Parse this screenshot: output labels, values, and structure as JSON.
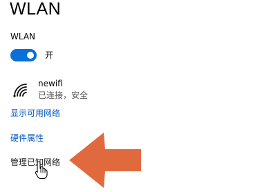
{
  "page": {
    "title": "WLAN"
  },
  "wlan": {
    "section_label": "WLAN",
    "toggle_state": "开",
    "toggle_on": true,
    "accent_color": "#0a6fd8"
  },
  "network": {
    "icon": "wifi-icon",
    "name": "newifi",
    "status": "已连接，安全"
  },
  "links": {
    "show_available": "显示可用网络",
    "hardware_properties": "硬件属性",
    "manage_known": "管理已知网络"
  },
  "overlay": {
    "arrow_icon": "arrow-left-icon",
    "arrow_color": "#e06a3e",
    "cursor_icon": "hand-pointer-icon"
  }
}
